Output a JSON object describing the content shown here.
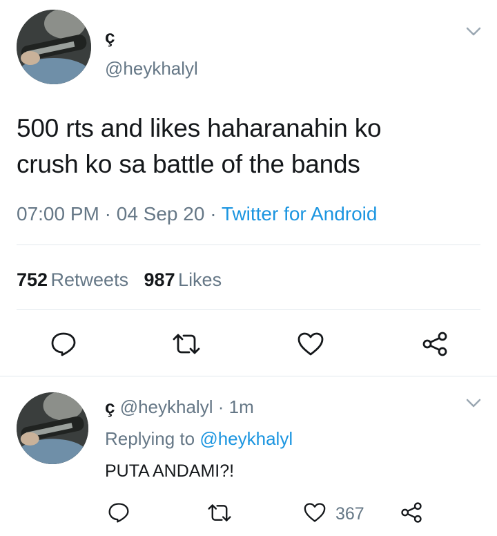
{
  "main_tweet": {
    "display_name": "ç",
    "handle": "@heykhalyl",
    "text_line1": "500 rts and likes haharanahin ko",
    "text_line2": "crush ko sa battle of the bands",
    "time": "07:00 PM",
    "date": "04 Sep 20",
    "separator": "·",
    "source": "Twitter for Android",
    "retweets_count": "752",
    "retweets_label": "Retweets",
    "likes_count": "987",
    "likes_label": "Likes"
  },
  "reply_tweet": {
    "display_name": "ç",
    "handle": "@heykhalyl",
    "age": "1m",
    "separator": "·",
    "replying_prefix": "Replying to",
    "replying_handle": "@heykhalyl",
    "text": "PUTA ANDAMI?!",
    "like_count": "367"
  },
  "icons": {
    "menu": "chevron-down-icon",
    "reply": "comment-bubble-icon",
    "retweet": "retweet-icon",
    "like": "heart-icon",
    "share": "share-nodes-icon"
  },
  "colors": {
    "text": "#14171a",
    "secondary": "#657786",
    "link": "#1b95e0",
    "divider": "#e1e8ed"
  }
}
